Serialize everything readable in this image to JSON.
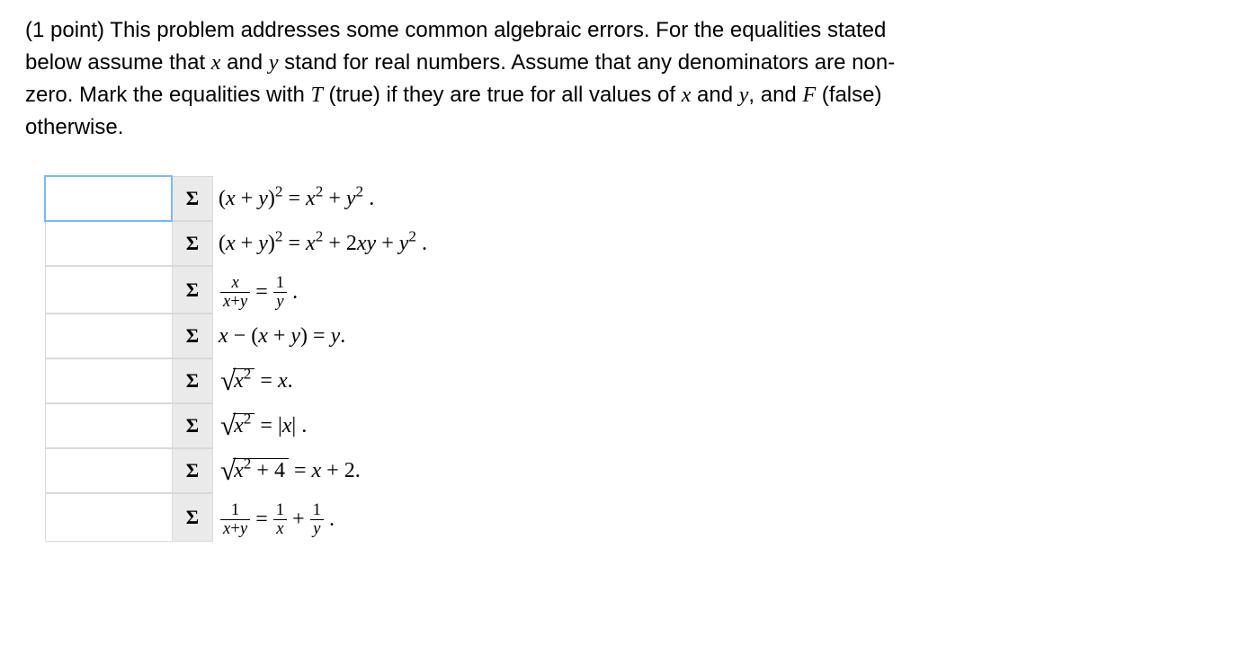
{
  "intro": {
    "points_prefix": "(1 point) ",
    "text_before_x": "This problem addresses some common algebraic errors. For the equalities stated below assume that ",
    "var_x": "x",
    "and": " and ",
    "var_y": "y",
    "text_mid": " stand for real numbers. Assume that any denominators are non-zero. Mark the equalities with ",
    "T": "T",
    "t_note": " (true) if they are true for all values of ",
    "var_x2": "x",
    "and2": " and ",
    "var_y2": "y",
    "text_and_f": ", and ",
    "F": "F",
    "f_note": " (false) otherwise."
  },
  "sigma": "Σ",
  "items": [
    {
      "html": "(<i>x</i> + <i>y</i>)<sup>2</sup> = <i>x</i><sup>2</sup> + <i>y</i><sup>2</sup> ."
    },
    {
      "html": "(<i>x</i> + <i>y</i>)<sup>2</sup> = <i>x</i><sup>2</sup> + 2<i>xy</i> + <i>y</i><sup>2</sup> ."
    },
    {
      "html": "<span class='eqline'><span class='frac'><span class='num'><i>x</i></span><span class='den'><i>x</i>+<i>y</i></span></span><span>=</span><span class='frac'><span class='num'>1</span><span class='den'><i>y</i></span></span><span>.</span></span>"
    },
    {
      "html": "<i>x</i> − (<i>x</i> + <i>y</i>) = <i>y</i>."
    },
    {
      "html": "<span class='sqrt'><span class='surd'>√</span><span class='arg'><i>x</i><sup>2</sup></span></span> = <i>x</i>."
    },
    {
      "html": "<span class='sqrt'><span class='surd'>√</span><span class='arg'><i>x</i><sup>2</sup></span></span> = |<i>x</i>| ."
    },
    {
      "html": "<span class='sqrt'><span class='surd'>√</span><span class='arg'><i>x</i><sup>2</sup> + 4</span></span> = <i>x</i> + 2."
    },
    {
      "html": "<span class='eqline'><span class='frac'><span class='num'>1</span><span class='den'><i>x</i>+<i>y</i></span></span><span>=</span><span class='frac'><span class='num'>1</span><span class='den'><i>x</i></span></span><span>+</span><span class='frac'><span class='num'>1</span><span class='den'><i>y</i></span></span><span>.</span></span>"
    }
  ]
}
